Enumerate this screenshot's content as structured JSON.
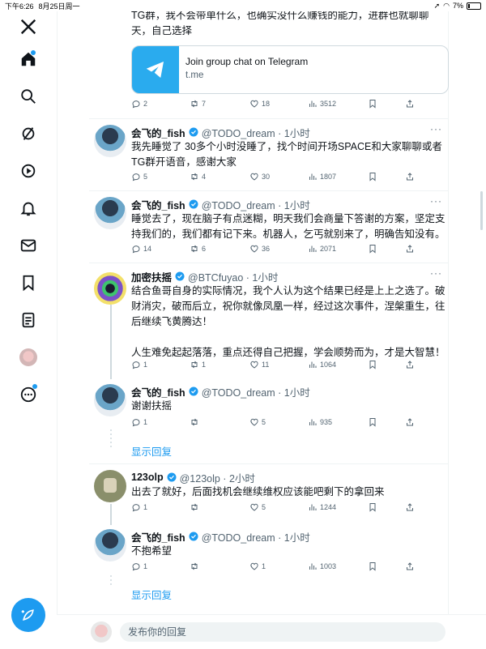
{
  "status": {
    "time": "下午6:26",
    "date": "8月25日周一",
    "battery": "7%"
  },
  "card": {
    "title": "Join group chat on Telegram",
    "domain": "t.me"
  },
  "posts": [
    {
      "text": "TG群，我不会带单什么，也确实没什么赚钱的能力，进群也就聊聊天，自己选择",
      "replies": "2",
      "retweets": "7",
      "likes": "18",
      "views": "3512"
    },
    {
      "name": "会飞的_fish",
      "handle": "@TODO_dream · 1小时",
      "text": "我先睡觉了 30多个小时没睡了，找个时间开场SPACE和大家聊聊或者TG群开语音，感谢大家",
      "replies": "5",
      "retweets": "4",
      "likes": "30",
      "views": "1807"
    },
    {
      "name": "会飞的_fish",
      "handle": "@TODO_dream · 1小时",
      "text": "睡觉去了，现在脑子有点迷糊，明天我们会商量下答谢的方案，坚定支持我们的，我们都有记下来。机器人，乞丐就别来了，明确告知没有。",
      "replies": "14",
      "retweets": "6",
      "likes": "36",
      "views": "2071"
    },
    {
      "name": "加密扶摇",
      "handle": "@BTCfuyao · 1小时",
      "text": "结合鱼哥自身的实际情况，我个人认为这个结果已经是上上之选了。破财消灾，破而后立，祝你就像凤凰一样，经过这次事件，涅槃重生，往后继续飞黄腾达！\n\n人生难免起起落落，重点还得自己把握，学会顺势而为，才是大智慧！",
      "replies": "1",
      "retweets": "1",
      "likes": "11",
      "views": "1064"
    },
    {
      "name": "会飞的_fish",
      "handle": "@TODO_dream · 1小时",
      "text": "谢谢扶摇",
      "replies": "1",
      "retweets": "",
      "likes": "5",
      "views": "935"
    },
    {
      "name": "123olp",
      "handle": "@123olp · 2小时",
      "text": "出去了就好，后面找机会继续维权应该能吧剩下的拿回来",
      "replies": "1",
      "retweets": "",
      "likes": "5",
      "views": "1244"
    },
    {
      "name": "会飞的_fish",
      "handle": "@TODO_dream · 1小时",
      "text": "不抱希望",
      "replies": "1",
      "retweets": "",
      "likes": "1",
      "views": "1003"
    }
  ],
  "show_replies": "显示回复",
  "reply_placeholder": "发布你的回复",
  "icons": {
    "logo": "x-logo-icon",
    "home": "home-icon",
    "search": "search-icon",
    "grok": "grok-icon",
    "video": "play-icon",
    "notifications": "bell-icon",
    "messages": "mail-icon",
    "bookmarks": "bookmark-icon",
    "lists": "list-icon",
    "profile": "avatar",
    "more": "more-circle-icon",
    "compose": "compose-icon"
  },
  "colors": {
    "accent": "#1d9bf0",
    "text": "#0f1419",
    "muted": "#536471",
    "border": "#eff3f4",
    "telegram": "#2aabee"
  }
}
